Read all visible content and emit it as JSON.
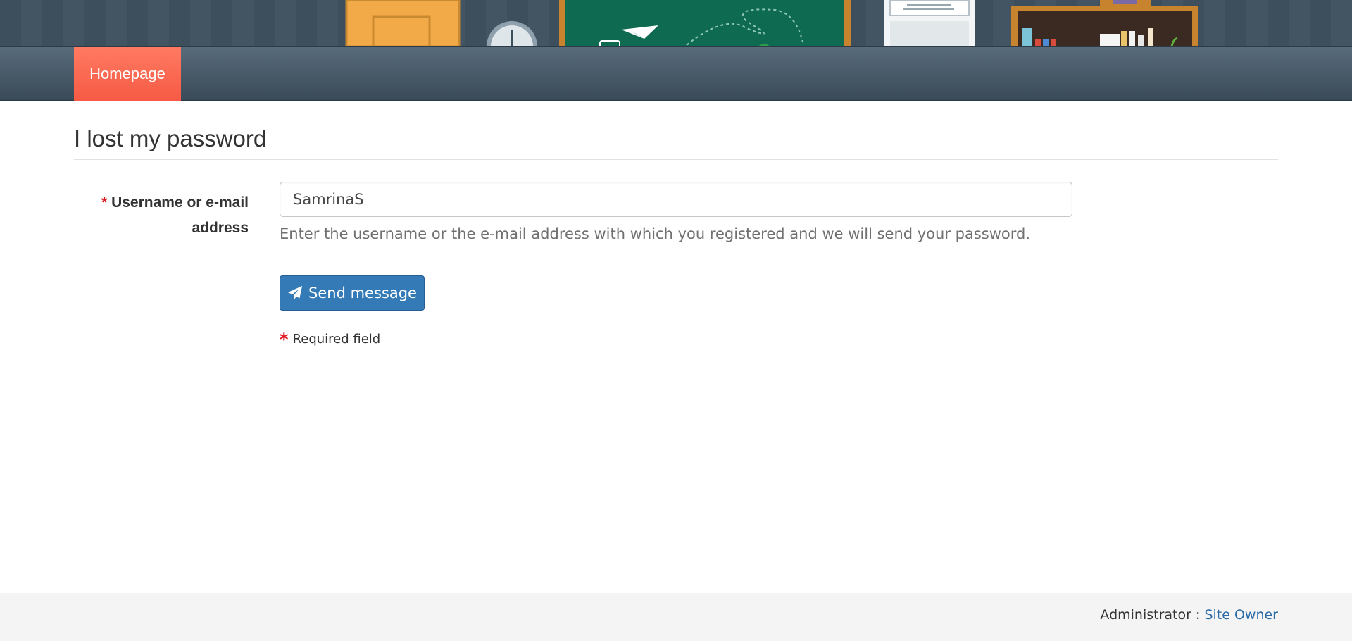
{
  "header": {
    "banner_name": "classroom-illustration",
    "nav": {
      "home_label": "Homepage"
    }
  },
  "main": {
    "title": "I lost my password",
    "form": {
      "required_mark": "*",
      "field_label": "Username or e-mail address",
      "username_value": "SamrinaS",
      "help_text": "Enter the username or the e-mail address with which you registered and we will send your password.",
      "submit_label": "Send message",
      "submit_icon": "paper-plane-icon",
      "required_note": "Required field"
    }
  },
  "footer": {
    "admin_label": "Administrator :",
    "admin_link": "Site Owner"
  },
  "colors": {
    "nav_active": "#f65a45",
    "primary_button": "#337ab7",
    "required": "#e0141e",
    "link": "#2a6aa6"
  }
}
